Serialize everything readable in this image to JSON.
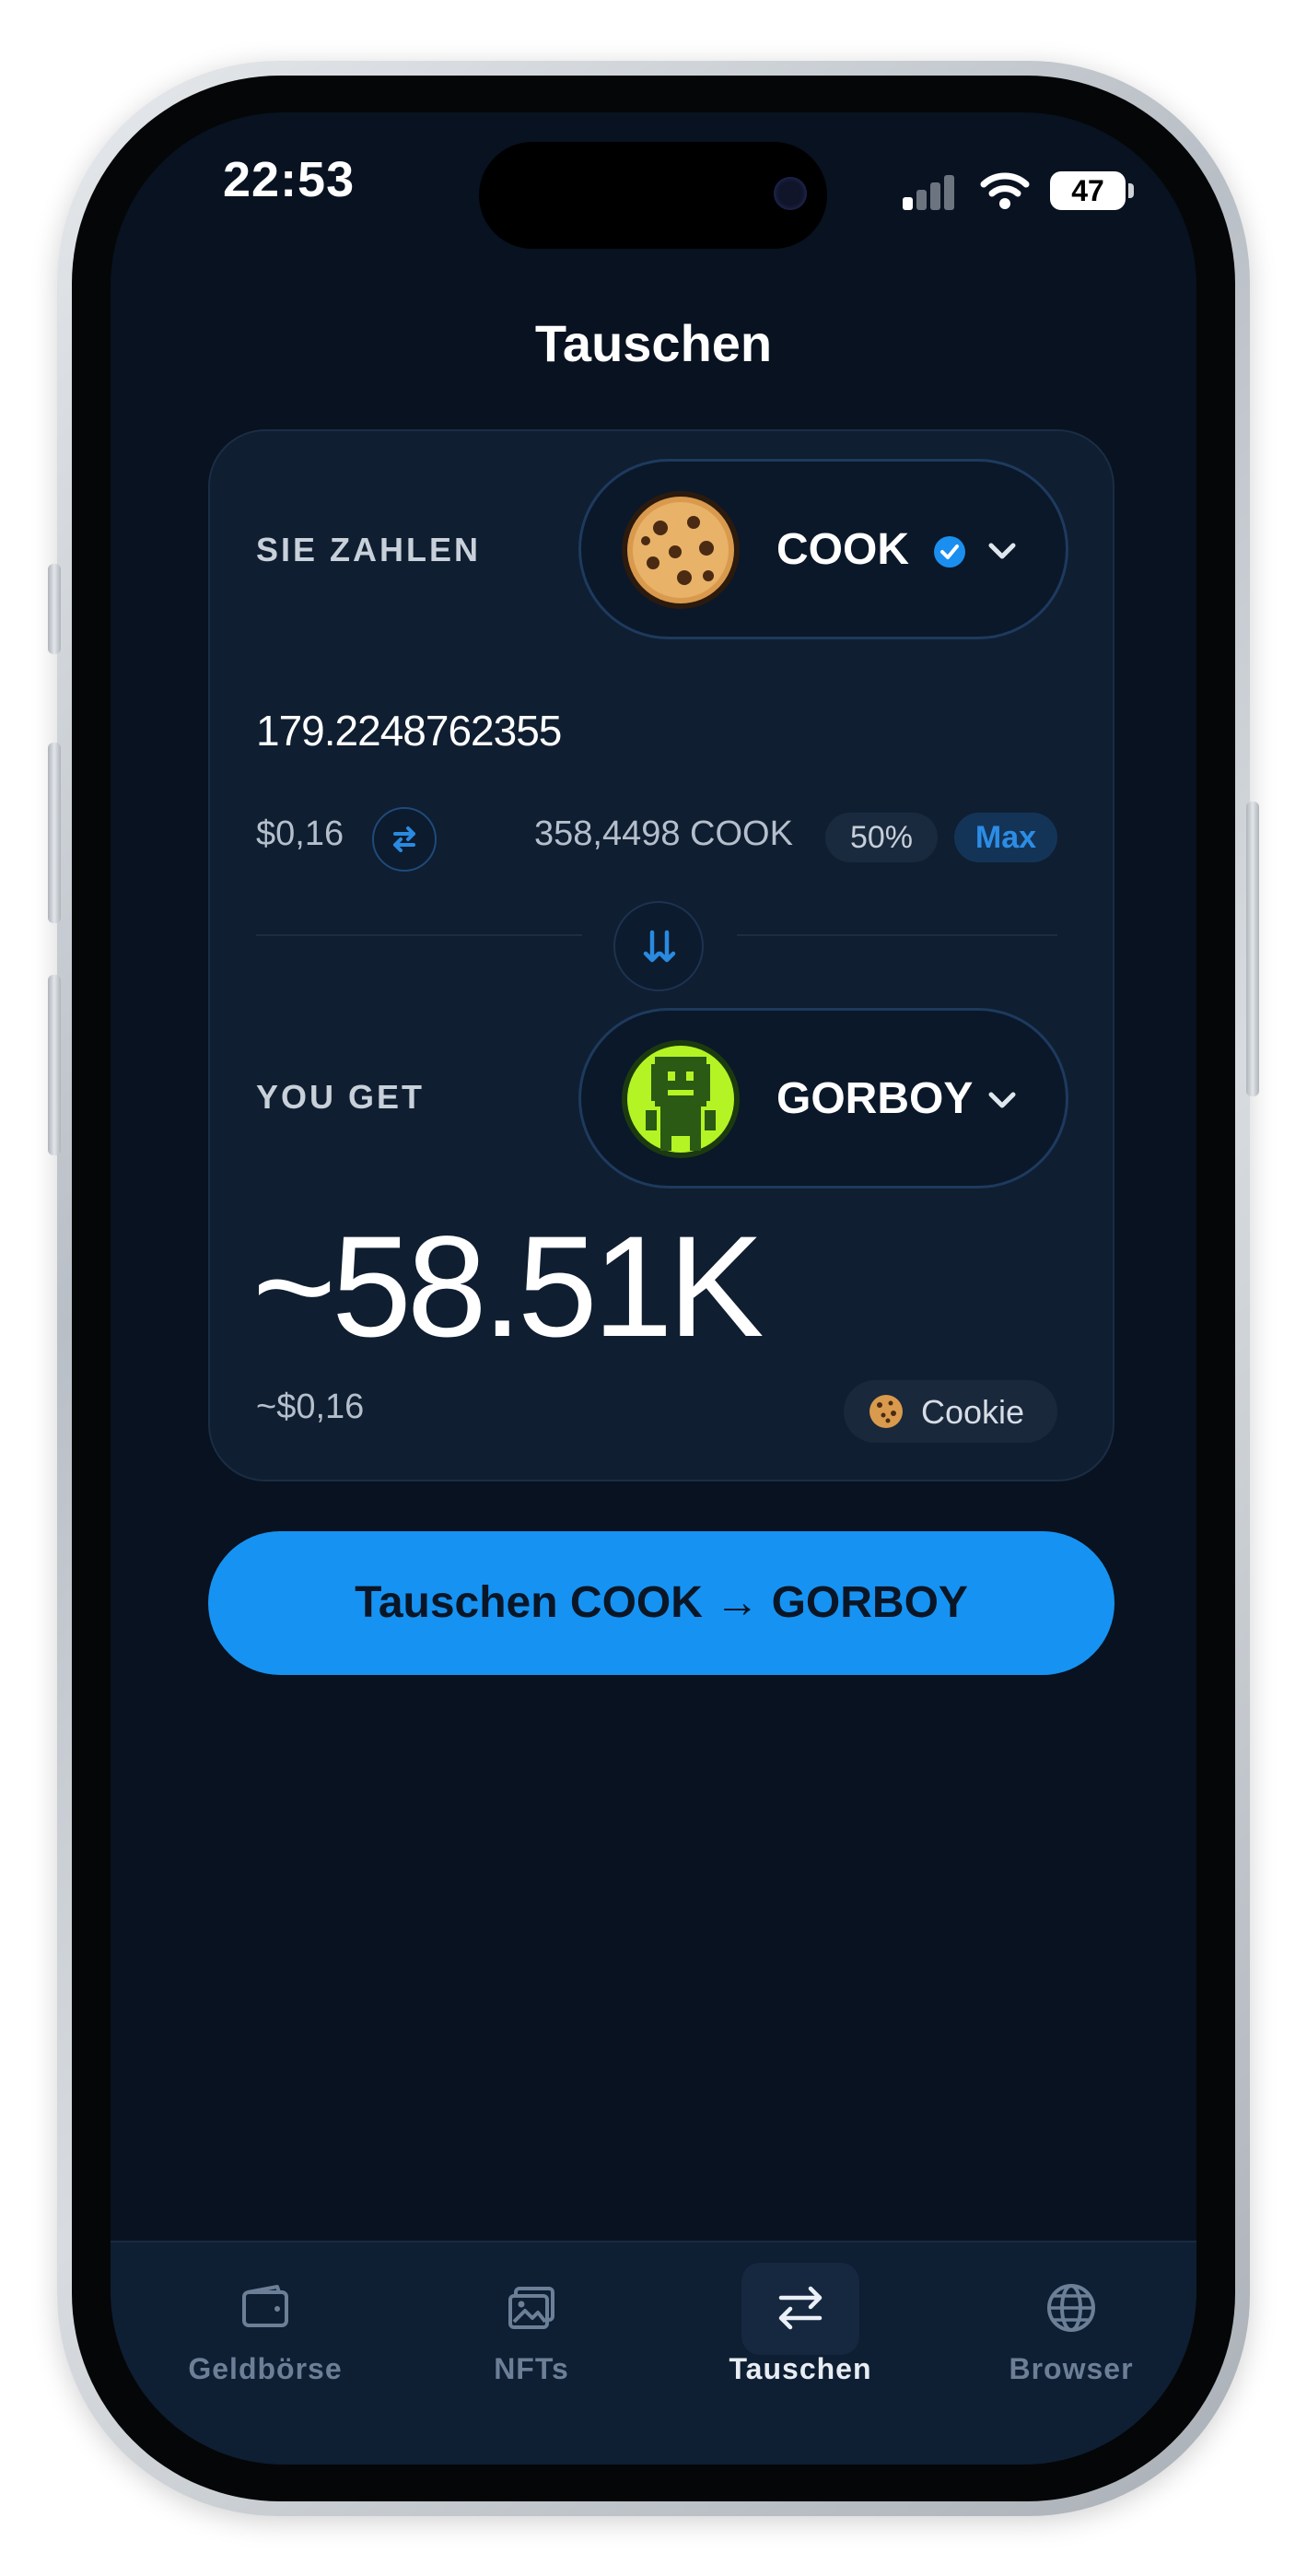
{
  "status_bar": {
    "time": "22:53",
    "battery": "47"
  },
  "page": {
    "title": "Tauschen"
  },
  "pay": {
    "label": "SIE ZAHLEN",
    "token": "COOK",
    "amount": "179.2248762355",
    "usd_value": "$0,16",
    "balance": "358,4498 COOK",
    "half_label": "50%",
    "max_label": "Max"
  },
  "receive": {
    "label": "YOU GET",
    "token": "GORBOY",
    "amount": "~58.51K",
    "usd_value": "~$0,16",
    "provider": "Cookie"
  },
  "cta": {
    "label": "Tauschen COOK → GORBOY"
  },
  "tabs": [
    {
      "label": "Geldbörse",
      "icon": "wallet-icon",
      "active": false
    },
    {
      "label": "NFTs",
      "icon": "image-icon",
      "active": false
    },
    {
      "label": "Tauschen",
      "icon": "swap-icon",
      "active": true
    },
    {
      "label": "Browser",
      "icon": "globe-icon",
      "active": false
    }
  ],
  "colors": {
    "accent": "#1693f2",
    "background": "#081220",
    "card": "#0f1e31",
    "verified": "#1a8ff0"
  }
}
